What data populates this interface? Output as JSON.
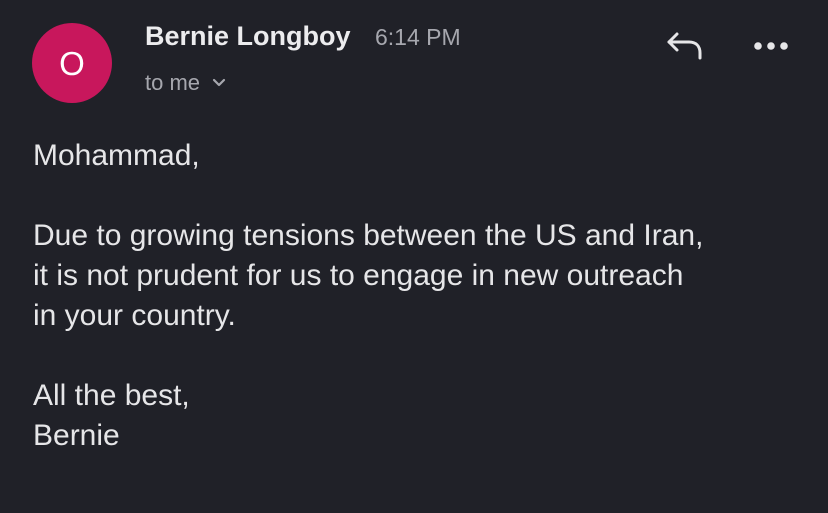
{
  "email": {
    "avatar_initial": "O",
    "avatar_color": "#c8175c",
    "sender_name": "Bernie Longboy",
    "time": "6:14 PM",
    "recipient": "to me",
    "icons": {
      "recipient_toggle": "chevron-down-icon",
      "reply": "reply-icon",
      "more": "more-options-icon"
    },
    "body": {
      "greeting": "Mohammad,",
      "paragraph_lines": [
        "Due to growing tensions between the US and Iran,",
        "it is not prudent for us to engage in new outreach",
        "in your country."
      ],
      "signoff": "All the best,",
      "signature": "Bernie"
    }
  }
}
